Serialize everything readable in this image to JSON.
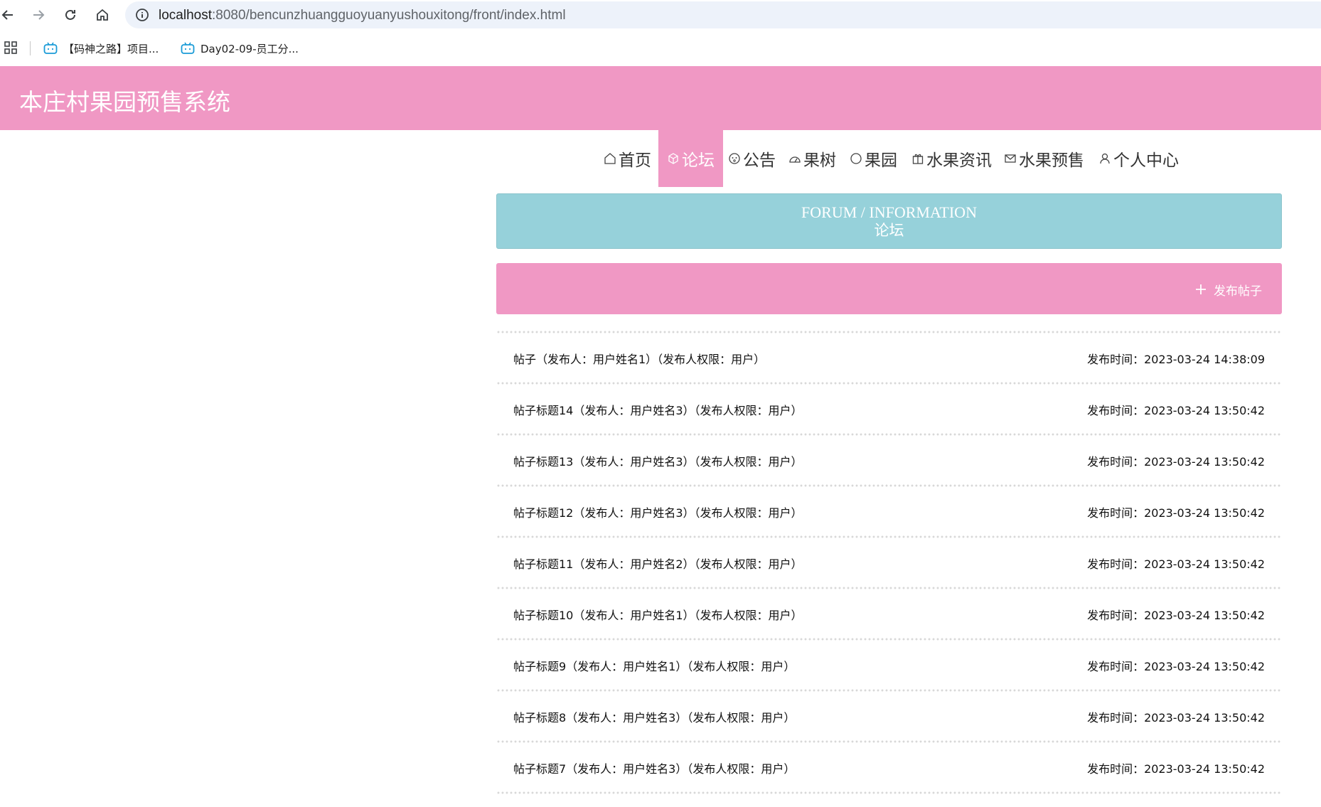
{
  "browser": {
    "url_host": "localhost",
    "url_path": ":8080/bencunzhuangguoyuanyushouxitong/front/index.html",
    "bookmarks": [
      {
        "label": "【码神之路】项目..."
      },
      {
        "label": "Day02-09-员工分..."
      }
    ]
  },
  "site": {
    "title": "本庄村果园预售系统"
  },
  "menu": [
    {
      "label": "首页",
      "icon": "home-icon",
      "active": false
    },
    {
      "label": "论坛",
      "icon": "cube-icon",
      "active": true
    },
    {
      "label": "公告",
      "icon": "face-icon",
      "active": false
    },
    {
      "label": "果树",
      "icon": "gauge-icon",
      "active": false
    },
    {
      "label": "果园",
      "icon": "circle-icon",
      "active": false
    },
    {
      "label": "水果资讯",
      "icon": "gift-icon",
      "active": false
    },
    {
      "label": "水果预售",
      "icon": "mail-icon",
      "active": false
    },
    {
      "label": "个人中心",
      "icon": "user-icon",
      "active": false
    }
  ],
  "banner": {
    "en": "FORUM / INFORMATION",
    "cn": "论坛"
  },
  "actions": {
    "post_label": "发布帖子"
  },
  "posts": [
    {
      "title": "帖子（发布人：用户姓名1）（发布人权限：用户）",
      "time": "发布时间：2023-03-24 14:38:09"
    },
    {
      "title": "帖子标题14（发布人：用户姓名3）（发布人权限：用户）",
      "time": "发布时间：2023-03-24 13:50:42"
    },
    {
      "title": "帖子标题13（发布人：用户姓名3）（发布人权限：用户）",
      "time": "发布时间：2023-03-24 13:50:42"
    },
    {
      "title": "帖子标题12（发布人：用户姓名3）（发布人权限：用户）",
      "time": "发布时间：2023-03-24 13:50:42"
    },
    {
      "title": "帖子标题11（发布人：用户姓名2）（发布人权限：用户）",
      "time": "发布时间：2023-03-24 13:50:42"
    },
    {
      "title": "帖子标题10（发布人：用户姓名1）（发布人权限：用户）",
      "time": "发布时间：2023-03-24 13:50:42"
    },
    {
      "title": "帖子标题9（发布人：用户姓名1）（发布人权限：用户）",
      "time": "发布时间：2023-03-24 13:50:42"
    },
    {
      "title": "帖子标题8（发布人：用户姓名3）（发布人权限：用户）",
      "time": "发布时间：2023-03-24 13:50:42"
    },
    {
      "title": "帖子标题7（发布人：用户姓名3）（发布人权限：用户）",
      "time": "发布时间：2023-03-24 13:50:42"
    }
  ],
  "colors": {
    "brand_pink": "#f098c4",
    "banner_teal": "#96d1da"
  }
}
